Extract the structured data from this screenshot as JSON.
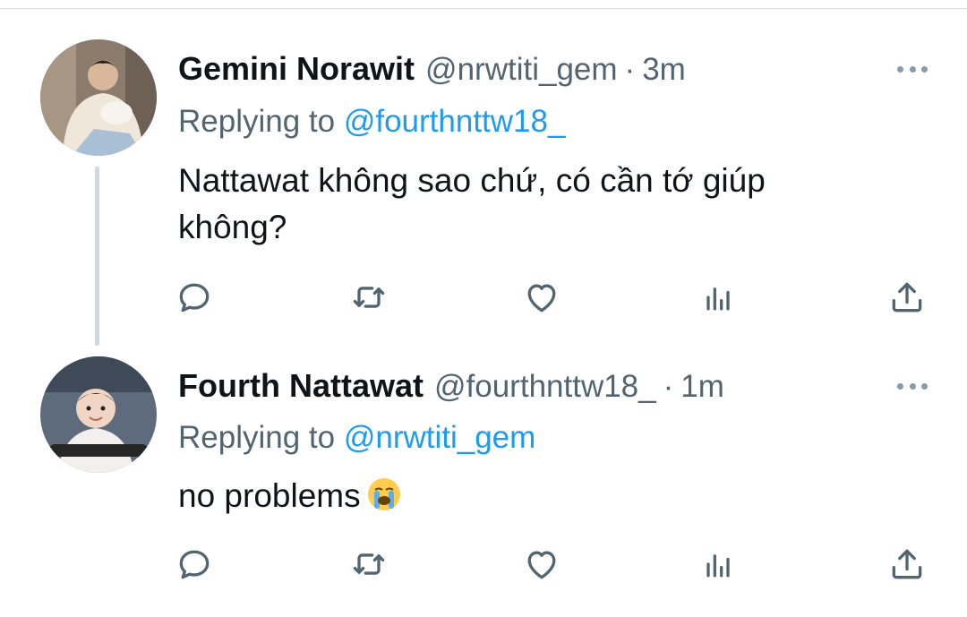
{
  "tweets": [
    {
      "name": "Gemini Norawit",
      "handle": "@nrwtiti_gem",
      "separator": "·",
      "time": "3m",
      "replying_prefix": "Replying to ",
      "replying_mention": "@fourthnttw18_",
      "text_line1": "Nattawat không sao chứ, có cần tớ giúp",
      "text_line2": "không?",
      "avatar": "avatar-photo-person-white-sweater"
    },
    {
      "name": "Fourth Nattawat",
      "handle": "@fourthnttw18_",
      "separator": "·",
      "time": "1m",
      "replying_prefix": "Replying to ",
      "replying_mention": "@nrwtiti_gem",
      "text": "no problems",
      "emoji": "loudly-crying-face",
      "avatar": "avatar-photo-baby-stroller"
    }
  ],
  "icons": {
    "reply": "speech-bubble-icon",
    "retweet": "retweet-icon",
    "like": "heart-icon",
    "views": "bar-chart-icon",
    "share": "share-upload-icon",
    "more": "more-dots-icon"
  },
  "colors": {
    "accent": "#1d9bf0",
    "secondary_text": "#536471",
    "icon": "#536471",
    "thread_line": "#cfd9de"
  }
}
